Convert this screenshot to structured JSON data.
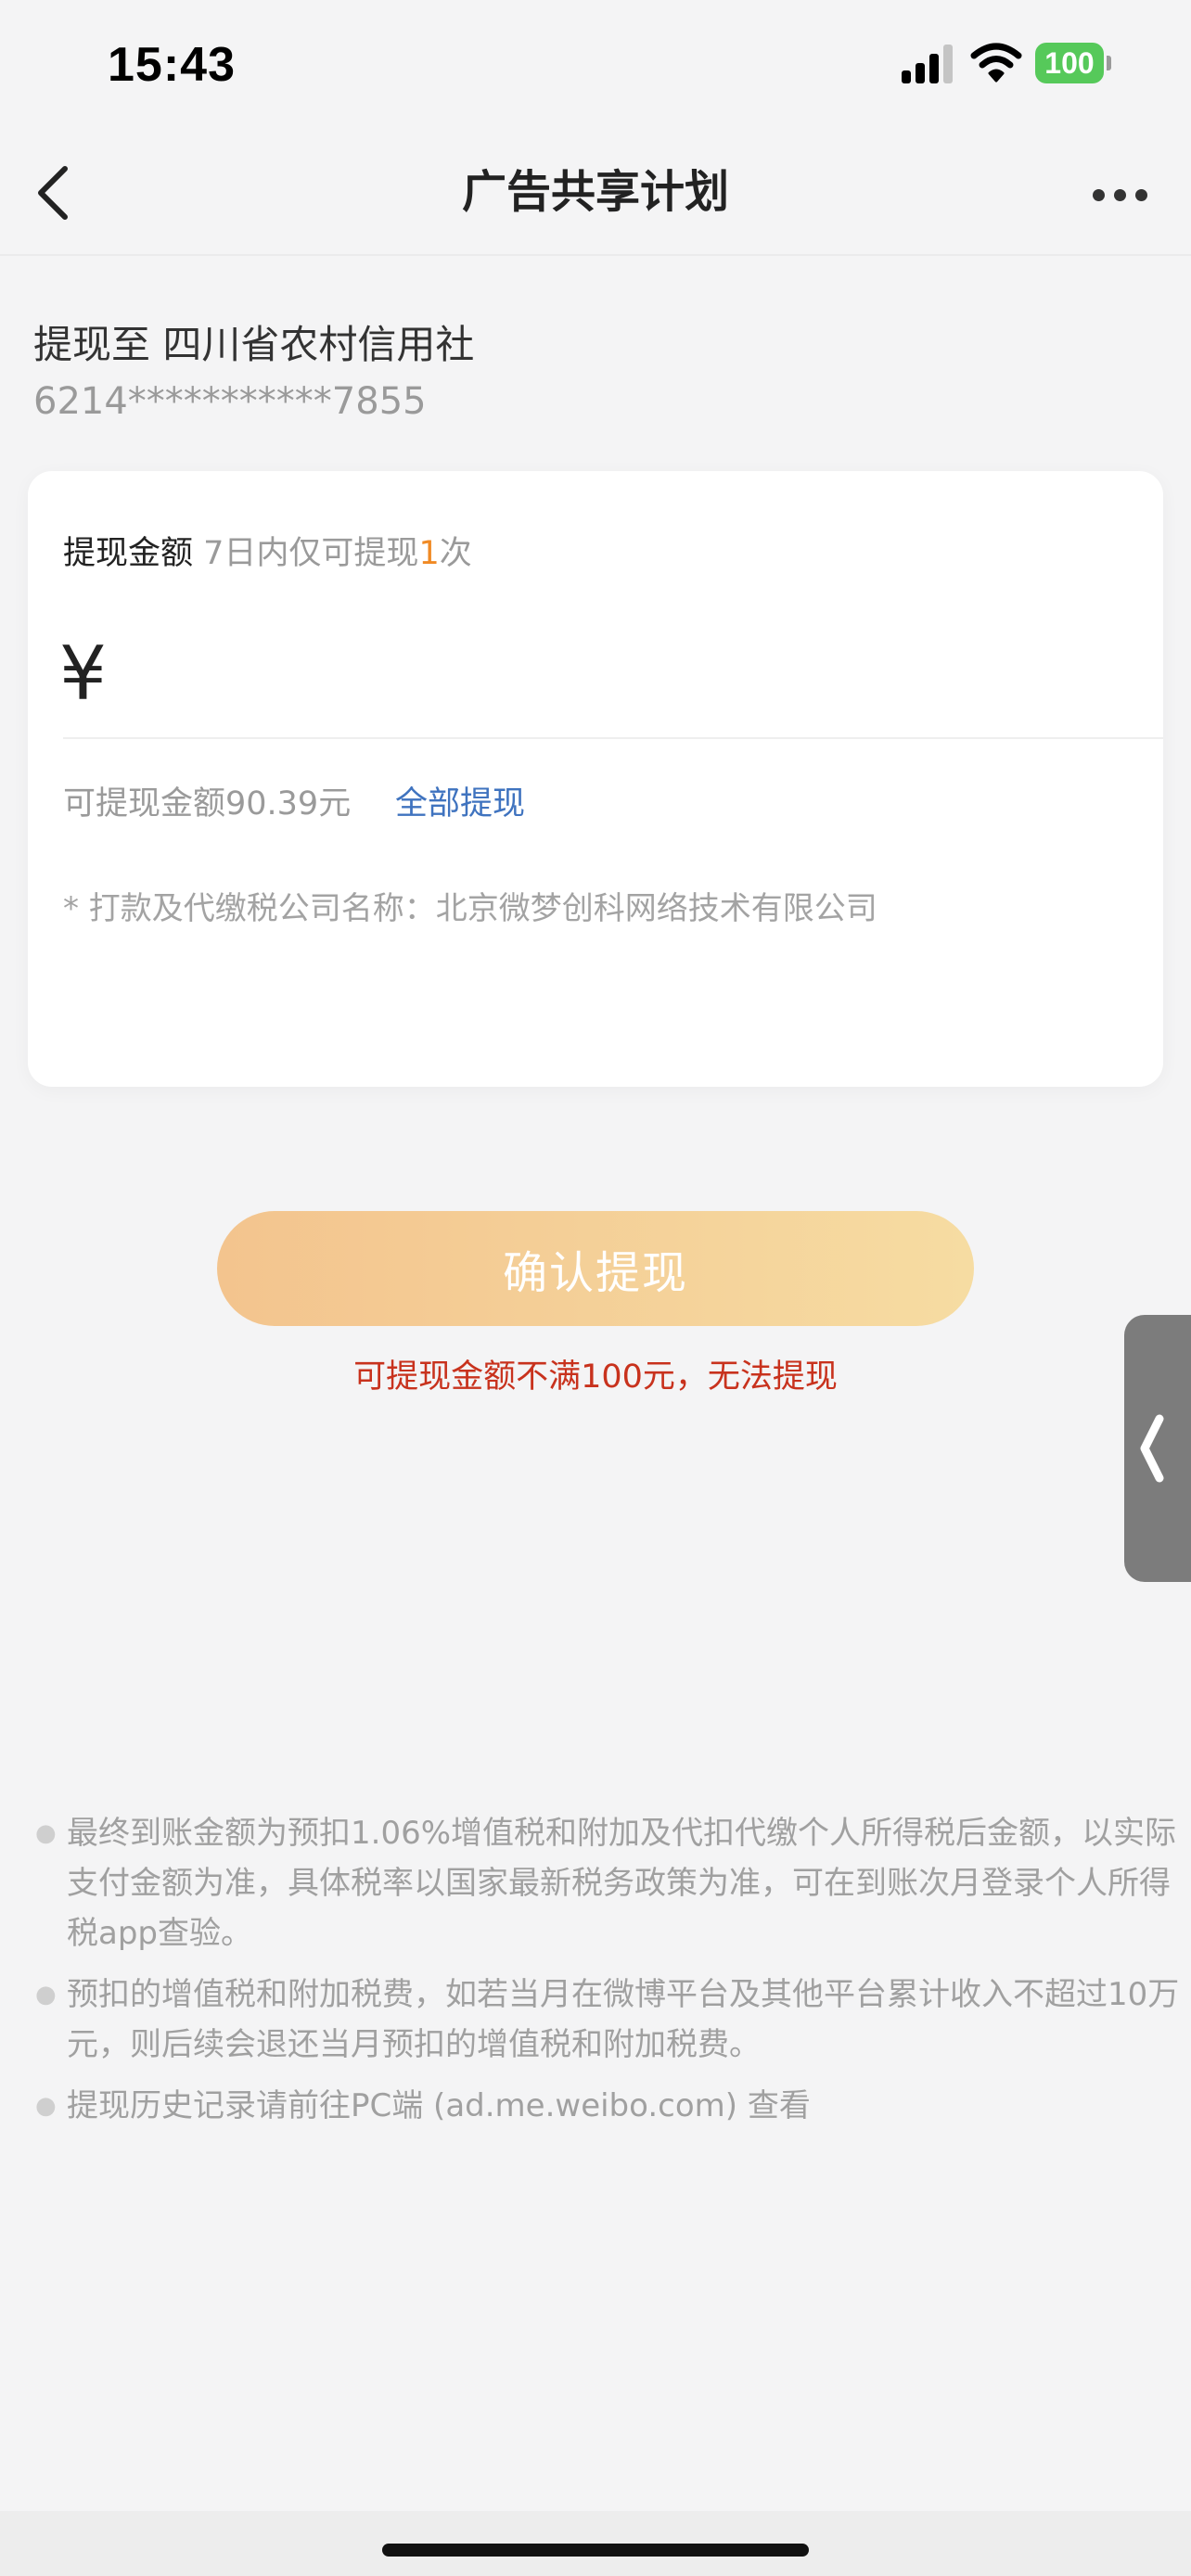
{
  "status_bar": {
    "time": "15:43",
    "battery_level": "100",
    "battery_color": "#56c95a"
  },
  "nav": {
    "title": "广告共享计划",
    "back_icon": "chevron-left-icon",
    "more_icon": "more-dots-icon"
  },
  "account": {
    "prefix": "提现至",
    "bank_name": "四川省农村信用社",
    "card_number": "6214***********7855"
  },
  "withdraw_card": {
    "amount_label": "提现金额",
    "limit_prefix": "7日内仅可提现",
    "limit_count": "1",
    "limit_suffix": "次",
    "currency_symbol": "¥",
    "amount_value": "",
    "available_text": "可提现金额90.39元",
    "withdraw_all_label": "全部提现",
    "company_note": "* 打款及代缴税公司名称：北京微梦创科网络技术有限公司"
  },
  "confirm": {
    "button_label": "确认提现",
    "warning_text": "可提现金额不满100元，无法提现"
  },
  "notes": [
    "最终到账金额为预扣1.06%增值税和附加及代扣代缴个人所得税后金额，以实际支付金额为准，具体税率以国家最新税务政策为准，可在到账次月登录个人所得税app查验。",
    "预扣的增值税和附加税费，如若当月在微博平台及其他平台累计收入不超过10万元，则后续会退还当月预扣的增值税和附加税费。",
    "提现历史记录请前往PC端 (ad.me.weibo.com) 查看"
  ],
  "colors": {
    "accent_orange": "#f08a24",
    "link_blue": "#3f73bf",
    "warning_red": "#c8321d",
    "button_gradient_start": "#f3c48e",
    "button_gradient_end": "#f6dca2"
  }
}
